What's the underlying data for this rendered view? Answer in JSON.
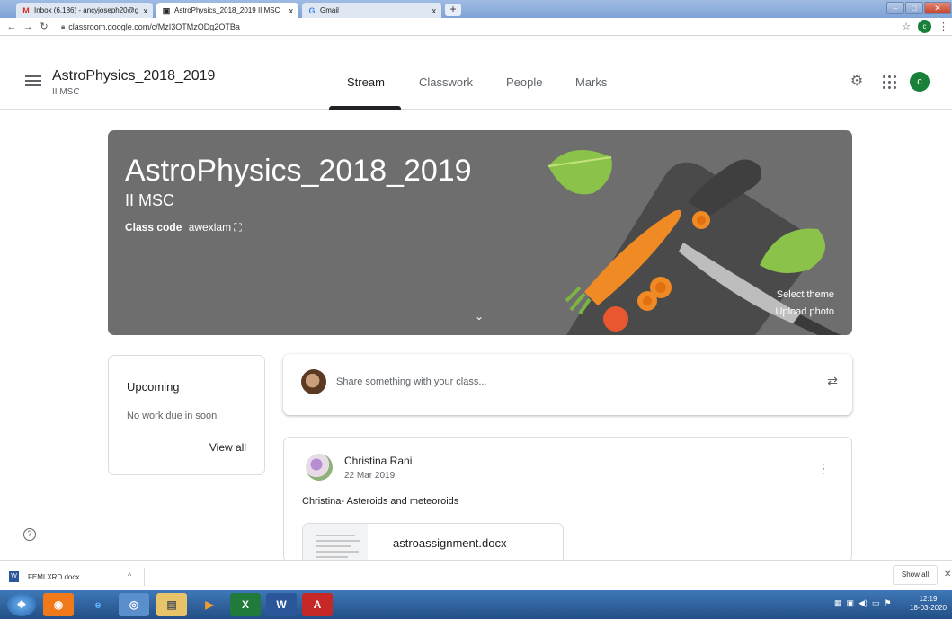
{
  "browser": {
    "tabs": [
      {
        "title": "Inbox (6,186) - ancyjoseph20@g",
        "close": "x",
        "favicon": "M",
        "favicon_color": "#d93025"
      },
      {
        "title": "AstroPhysics_2018_2019 II MSC",
        "close": "x",
        "favicon": "▣",
        "favicon_color": "#202124"
      },
      {
        "title": "Gmail",
        "close": "x",
        "favicon": "G",
        "favicon_color": "#4285f4"
      }
    ],
    "new_tab_label": "+",
    "url": "classroom.google.com/c/MzI3OTMzODg2OTBa",
    "profile_initial": "c"
  },
  "header": {
    "class_title": "AstroPhysics_2018_2019",
    "class_section": "II MSC",
    "tabs": [
      {
        "label": "Stream"
      },
      {
        "label": "Classwork"
      },
      {
        "label": "People"
      },
      {
        "label": "Marks"
      }
    ],
    "avatar_initial": "c",
    "accent": "#188038"
  },
  "banner": {
    "title": "AstroPhysics_2018_2019",
    "section": "II MSC",
    "class_code_label": "Class code",
    "class_code": "awexlam",
    "select_theme": "Select theme",
    "upload_photo": "Upload photo",
    "background": "#6e6e6e"
  },
  "upcoming": {
    "title": "Upcoming",
    "empty_text": "No work due in soon",
    "view_all": "View all"
  },
  "share": {
    "placeholder": "Share something with your class..."
  },
  "post": {
    "author": "Christina Rani",
    "date": "22 Mar 2019",
    "text": "Christina- Asteroids and meteoroids",
    "attachment": "astroassignment.docx"
  },
  "downloads": {
    "file": "FEMI XRD.docx",
    "show_all": "Show all"
  },
  "taskbar": {
    "time": "12:19",
    "date": "18-03-2020"
  }
}
